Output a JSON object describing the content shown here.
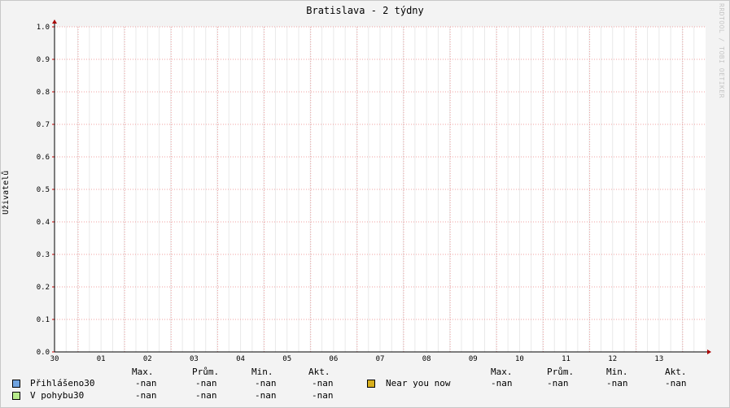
{
  "chart_data": {
    "type": "line",
    "title": "Bratislava - 2 týdny",
    "xlabel": "",
    "ylabel": "Uživatelů",
    "ylim": [
      0,
      1.0
    ],
    "yticks": [
      "0.0",
      "0.1",
      "0.2",
      "0.3",
      "0.4",
      "0.5",
      "0.6",
      "0.7",
      "0.8",
      "0.9",
      "1.0"
    ],
    "xticks": [
      "30",
      "01",
      "02",
      "03",
      "04",
      "05",
      "06",
      "07",
      "08",
      "09",
      "10",
      "11",
      "12",
      "13"
    ],
    "grid": true,
    "series": [
      {
        "name": "Přihlášeno30",
        "color": "#6fa3e0",
        "values": []
      },
      {
        "name": "V pohybu30",
        "color": "#b8ec8c",
        "values": []
      },
      {
        "name": "Near you now",
        "color": "#d7ae1c",
        "values": []
      }
    ]
  },
  "legend": {
    "col_headers": [
      "Max.",
      "Prům.",
      "Min.",
      "Akt."
    ],
    "rows": [
      {
        "name": "Přihlášeno30",
        "color": "#6fa3e0",
        "values": [
          "-nan",
          "-nan",
          "-nan",
          "-nan"
        ]
      },
      {
        "name": "V pohybu30",
        "color": "#b8ec8c",
        "values": [
          "-nan",
          "-nan",
          "-nan",
          "-nan"
        ]
      }
    ],
    "right_rows": [
      {
        "name": "Near you now",
        "color": "#d7ae1c",
        "values": [
          "-nan",
          "-nan",
          "-nan",
          "-nan"
        ]
      }
    ]
  },
  "watermark": "RRDTOOL / TOBI OETIKER"
}
